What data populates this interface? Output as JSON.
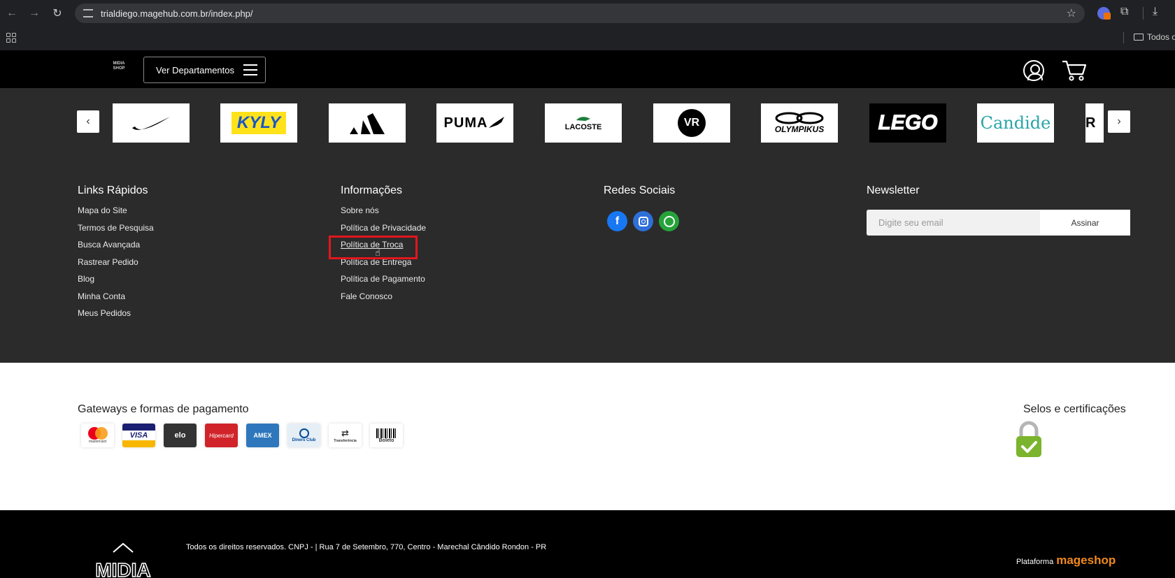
{
  "browser": {
    "url": "trialdiego.magehub.com.br/index.php/",
    "bookmark_folder": "Todos o"
  },
  "header": {
    "logo_text": "MIDIA SHOP",
    "departments_label": "Ver Departamentos"
  },
  "brands": [
    {
      "name": "NIKE"
    },
    {
      "name": "KYLY"
    },
    {
      "name": "adidas"
    },
    {
      "name": "PUMA"
    },
    {
      "name": "LACOSTE"
    },
    {
      "name": "VR EDITORAS"
    },
    {
      "name": "OLYMPIKUS"
    },
    {
      "name": "LEGO"
    },
    {
      "name": "Candide"
    },
    {
      "name": "R"
    }
  ],
  "footer": {
    "links_rapidos": {
      "title": "Links Rápidos",
      "items": [
        "Mapa do Site",
        "Termos de Pesquisa",
        "Busca Avançada",
        "Rastrear Pedido",
        "Blog",
        "Minha Conta",
        "Meus Pedidos"
      ]
    },
    "informacoes": {
      "title": "Informações",
      "items": [
        "Sobre nós",
        "Política de Privacidade",
        "Política de Troca",
        "Política de Entrega",
        "Política de Pagamento",
        "Fale Conosco"
      ]
    },
    "redes_sociais": {
      "title": "Redes Sociais",
      "icons": [
        "facebook-icon",
        "instagram-icon",
        "whatsapp-icon"
      ],
      "colors": [
        "#1877f2",
        "#2f6fd8",
        "#25a33a"
      ]
    },
    "newsletter": {
      "title": "Newsletter",
      "placeholder": "Digite seu email",
      "button": "Assinar"
    }
  },
  "payments": {
    "title": "Gateways e formas de pagamento",
    "methods": [
      "mastercard",
      "VISA",
      "elo",
      "Hipercard",
      "AMEX",
      "Diners Club",
      "Transferência",
      "Boleto"
    ]
  },
  "selos": {
    "title": "Selos e certificações"
  },
  "bottom": {
    "copyright": "Todos os direitos reservados. CNPJ - | Rua 7 de Setembro, 770, Centro - Marechal Cândido Rondon - PR",
    "plataforma": "Plataforma",
    "mageshop": "mageshop",
    "logo_text": "MIDIA"
  }
}
